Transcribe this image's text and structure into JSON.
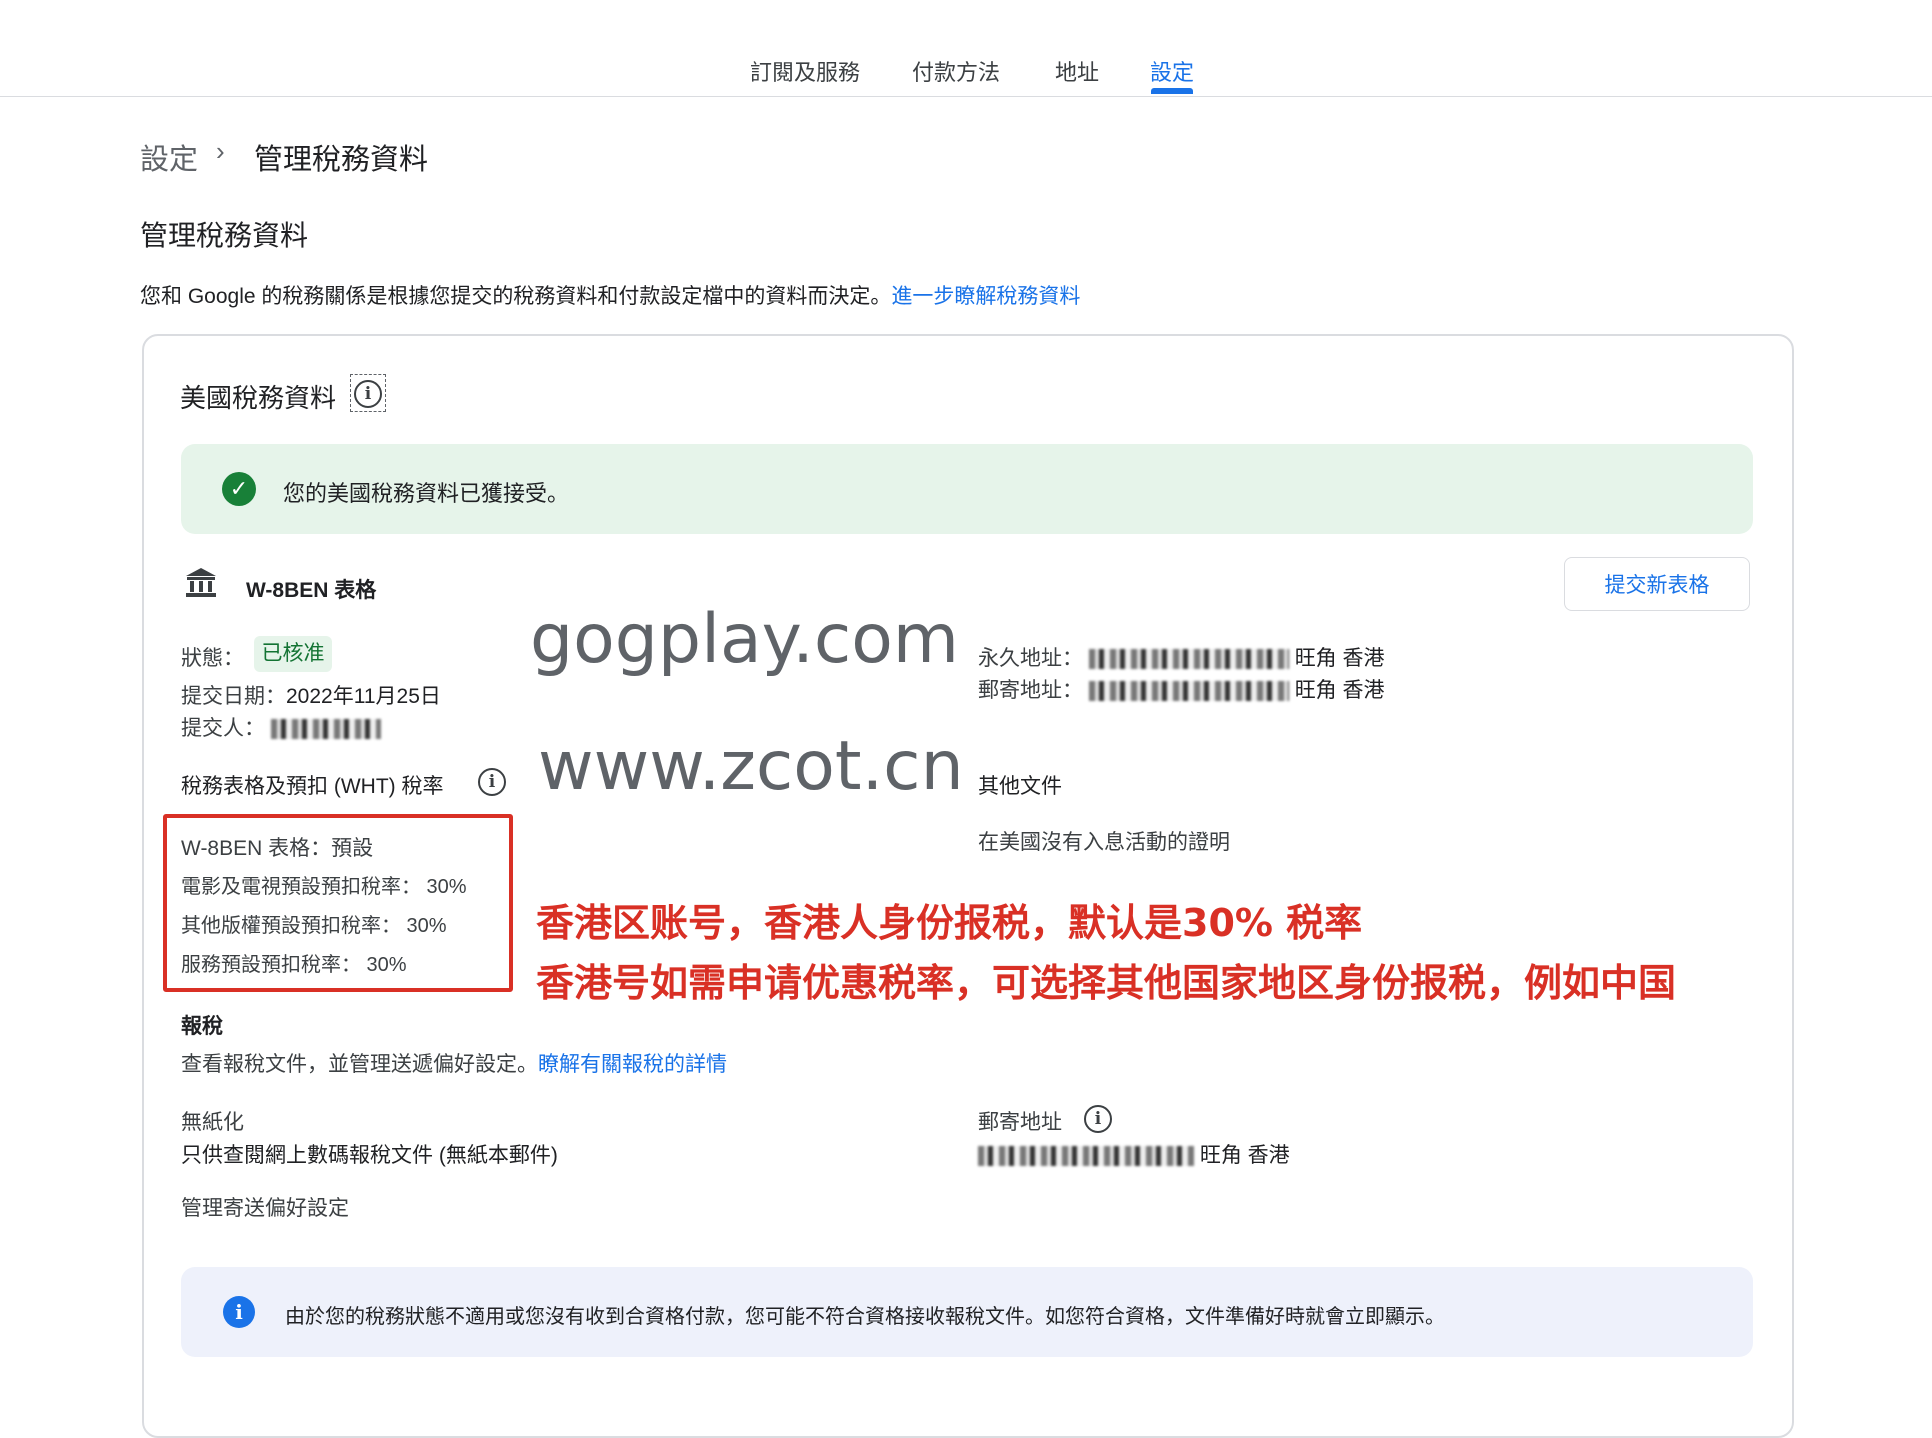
{
  "tabs": [
    {
      "label": "訂閱及服務"
    },
    {
      "label": "付款方法"
    },
    {
      "label": "地址"
    },
    {
      "label": "設定",
      "active": true
    }
  ],
  "breadcrumb": {
    "parent": "設定",
    "separator": "›",
    "current": "管理稅務資料"
  },
  "page": {
    "title": "管理稅務資料",
    "description": "您和 Google 的稅務關係是根據您提交的稅務資料和付款設定檔中的資料而決定。",
    "learn_more_link": "進一步瞭解稅務資料"
  },
  "card": {
    "title": "美國稅務資料",
    "success_message": "您的美國稅務資料已獲接受。",
    "form_name": "W-8BEN 表格",
    "submit_button": "提交新表格",
    "status_label": "狀態：",
    "status_value": "已核准",
    "date_label": "提交日期：",
    "date_value": "2022年11月25日",
    "submitter_label": "提交人：",
    "permanent_address_label": "永久地址：",
    "permanent_address_suffix": "旺角 香港",
    "mailing_address_label": "郵寄地址：",
    "mailing_address_suffix": "旺角 香港",
    "wht_title": "稅務表格及預扣 (WHT) 稅率",
    "wht_form_link": "W-8BEN 表格：預設",
    "wht_items": [
      "電影及電視預設預扣稅率： 30%",
      "其他版權預設預扣稅率： 30%",
      "服務預設預扣稅率： 30%"
    ],
    "other_docs_title": "其他文件",
    "other_docs_link": "在美國沒有入息活動的證明",
    "tax_report_title": "報稅",
    "tax_report_desc": "查看報稅文件，並管理送遞偏好設定。",
    "tax_report_link": "瞭解有關報稅的詳情",
    "paperless_label": "無紙化",
    "paperless_value": "只供查閱網上數碼報稅文件 (無紙本郵件)",
    "mailing_label": "郵寄地址",
    "mailing_value_suffix": "旺角 香港",
    "manage_link": "管理寄送偏好設定",
    "notice": "由於您的稅務狀態不適用或您沒有收到合資格付款，您可能不符合資格接收報稅文件。如您符合資格，文件準備好時就會立即顯示。"
  },
  "overlay": {
    "watermark_1": "gogplay.com",
    "watermark_2": "www.zcot.cn",
    "note_line_1": "香港区账号，香港人身份报税，默认是30% 税率",
    "note_line_2": "香港号如需申请优惠税率，可选择其他国家地区身份报税，例如中国"
  },
  "colors": {
    "accent": "#1a73e8",
    "success": "#188038",
    "annotation": "#d93025"
  }
}
